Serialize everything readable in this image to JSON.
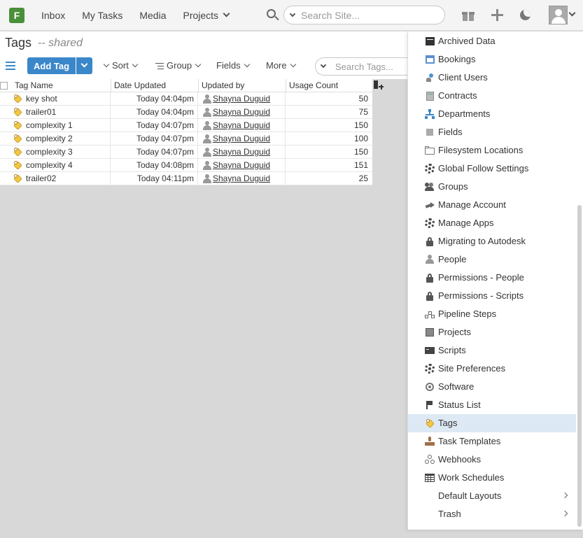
{
  "nav": {
    "logo_letter": "F",
    "links": [
      "Inbox",
      "My Tasks",
      "Media",
      "Projects"
    ],
    "search_placeholder": "Search Site..."
  },
  "page": {
    "title": "Tags",
    "subtitle": "-- shared"
  },
  "toolbar": {
    "add_label": "Add Tag",
    "sort_label": "Sort",
    "group_label": "Group",
    "fields_label": "Fields",
    "more_label": "More",
    "search_placeholder": "Search Tags..."
  },
  "table": {
    "columns": [
      "Tag Name",
      "Date Updated",
      "Updated by",
      "Usage Count"
    ],
    "rows": [
      {
        "name": "key shot",
        "date": "Today 04:04pm",
        "user": "Shayna Duguid",
        "count": "50"
      },
      {
        "name": "trailer01",
        "date": "Today 04:04pm",
        "user": "Shayna Duguid",
        "count": "75"
      },
      {
        "name": "complexity 1",
        "date": "Today 04:07pm",
        "user": "Shayna Duguid",
        "count": "150"
      },
      {
        "name": "complexity 2",
        "date": "Today 04:07pm",
        "user": "Shayna Duguid",
        "count": "100"
      },
      {
        "name": "complexity 3",
        "date": "Today 04:07pm",
        "user": "Shayna Duguid",
        "count": "150"
      },
      {
        "name": "complexity 4",
        "date": "Today 04:08pm",
        "user": "Shayna Duguid",
        "count": "151"
      },
      {
        "name": "trailer02",
        "date": "Today 04:11pm",
        "user": "Shayna Duguid",
        "count": "25"
      }
    ]
  },
  "menu": {
    "items": [
      {
        "label": "Archived Data",
        "icon": "archive-icon"
      },
      {
        "label": "Bookings",
        "icon": "calendar-icon"
      },
      {
        "label": "Client Users",
        "icon": "client-user-icon"
      },
      {
        "label": "Contracts",
        "icon": "contract-icon"
      },
      {
        "label": "Departments",
        "icon": "hierarchy-icon"
      },
      {
        "label": "Fields",
        "icon": "field-icon"
      },
      {
        "label": "Filesystem Locations",
        "icon": "folder-icon"
      },
      {
        "label": "Global Follow Settings",
        "icon": "gear-icon"
      },
      {
        "label": "Groups",
        "icon": "group-icon"
      },
      {
        "label": "Manage Account",
        "icon": "share-arrow-icon"
      },
      {
        "label": "Manage Apps",
        "icon": "gear-icon"
      },
      {
        "label": "Migrating to Autodesk",
        "icon": "lock-icon"
      },
      {
        "label": "People",
        "icon": "person-icon"
      },
      {
        "label": "Permissions - People",
        "icon": "lock-icon"
      },
      {
        "label": "Permissions - Scripts",
        "icon": "lock-icon"
      },
      {
        "label": "Pipeline Steps",
        "icon": "pipeline-icon"
      },
      {
        "label": "Projects",
        "icon": "project-icon"
      },
      {
        "label": "Scripts",
        "icon": "terminal-icon"
      },
      {
        "label": "Site Preferences",
        "icon": "gear-icon"
      },
      {
        "label": "Software",
        "icon": "disc-icon"
      },
      {
        "label": "Status List",
        "icon": "flag-icon"
      },
      {
        "label": "Tags",
        "icon": "tag-icon",
        "active": true
      },
      {
        "label": "Task Templates",
        "icon": "stamp-icon"
      },
      {
        "label": "Webhooks",
        "icon": "webhook-icon"
      },
      {
        "label": "Work Schedules",
        "icon": "table-grid-icon"
      },
      {
        "label": "Default Layouts",
        "icon": "",
        "submenu": true
      },
      {
        "label": "Trash",
        "icon": "",
        "submenu": true
      }
    ]
  },
  "colors": {
    "accent": "#3a87c9",
    "logo": "#4a8f3a",
    "active_menu": "#dde9f4"
  }
}
